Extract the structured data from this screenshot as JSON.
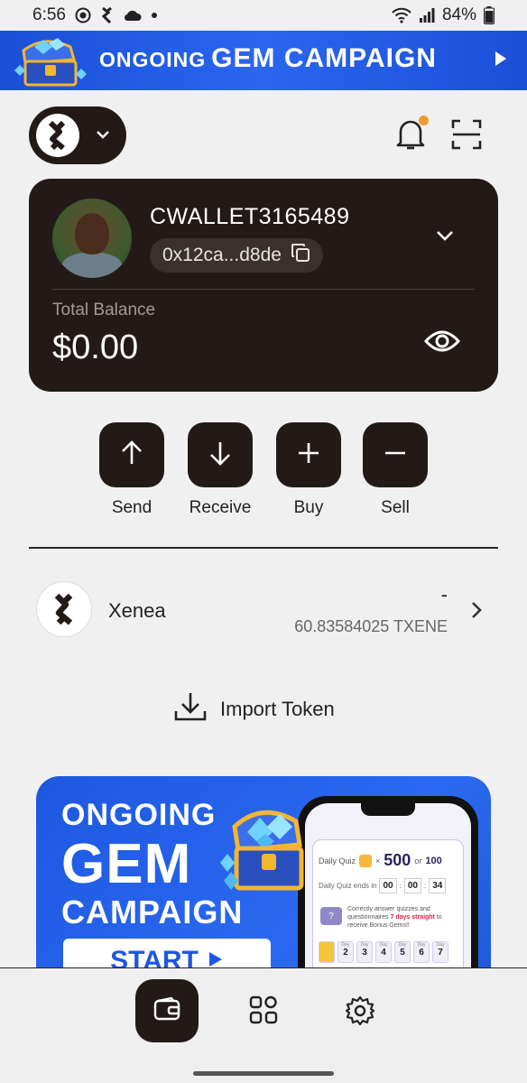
{
  "status_bar": {
    "time": "6:56",
    "battery": "84%"
  },
  "top_banner": {
    "line_small": "ONGOING",
    "line_big": "GEM CAMPAIGN"
  },
  "wallet": {
    "name": "CWALLET3165489",
    "address": "0x12ca...d8de",
    "balance_label": "Total Balance",
    "balance": "$0.00"
  },
  "actions": [
    {
      "label": "Send",
      "icon": "arrow-up-icon"
    },
    {
      "label": "Receive",
      "icon": "arrow-down-icon"
    },
    {
      "label": "Buy",
      "icon": "plus-icon"
    },
    {
      "label": "Sell",
      "icon": "minus-icon"
    }
  ],
  "tokens": [
    {
      "name": "Xenea",
      "fiat": "-",
      "amount": "60.83584025 TXENE"
    }
  ],
  "import_token": {
    "label": "Import Token"
  },
  "promo": {
    "line1": "ONGOING",
    "line2": "GEM",
    "line3": "CAMPAIGN",
    "start": "START",
    "quiz": {
      "title": "Daily Quiz",
      "multiplier": "×",
      "value_big": "500",
      "or": "or",
      "value_small": "100",
      "ends_label": "Daily Quiz ends in",
      "hh": "00",
      "mm": "00",
      "ss": "34",
      "desc_start": "Correctly answer quizzes and questionnaires",
      "desc_bold": "7 days straight",
      "desc_end": "to receive Bonus Gems!!",
      "days": [
        "2",
        "3",
        "4",
        "5",
        "6",
        "7"
      ],
      "day_label": "Day"
    }
  },
  "colors": {
    "dark": "#231a17",
    "banner_blue": "#1d57e0",
    "notify_dot": "#f29a2e"
  }
}
